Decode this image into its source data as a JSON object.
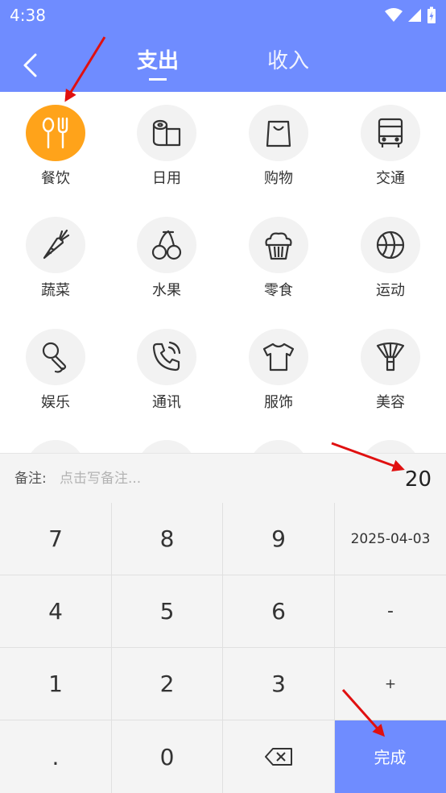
{
  "status_bar": {
    "time": "4:38"
  },
  "header": {
    "tabs": [
      {
        "label": "支出",
        "active": true
      },
      {
        "label": "收入",
        "active": false
      }
    ]
  },
  "categories": [
    {
      "label": "餐饮",
      "icon": "utensils-icon",
      "selected": true
    },
    {
      "label": "日用",
      "icon": "tissue-roll-icon",
      "selected": false
    },
    {
      "label": "购物",
      "icon": "shopping-bag-icon",
      "selected": false
    },
    {
      "label": "交通",
      "icon": "bus-icon",
      "selected": false
    },
    {
      "label": "蔬菜",
      "icon": "carrot-icon",
      "selected": false
    },
    {
      "label": "水果",
      "icon": "cherry-icon",
      "selected": false
    },
    {
      "label": "零食",
      "icon": "cupcake-icon",
      "selected": false
    },
    {
      "label": "运动",
      "icon": "basketball-icon",
      "selected": false
    },
    {
      "label": "娱乐",
      "icon": "microphone-icon",
      "selected": false
    },
    {
      "label": "通讯",
      "icon": "phone-icon",
      "selected": false
    },
    {
      "label": "服饰",
      "icon": "tshirt-icon",
      "selected": false
    },
    {
      "label": "美容",
      "icon": "brush-icon",
      "selected": false
    }
  ],
  "note": {
    "label": "备注:",
    "placeholder": "点击写备注...",
    "value": ""
  },
  "amount": "20",
  "keypad": {
    "k7": "7",
    "k8": "8",
    "k9": "9",
    "date": "2025-04-03",
    "k4": "4",
    "k5": "5",
    "k6": "6",
    "minus": "-",
    "k1": "1",
    "k2": "2",
    "k3": "3",
    "plus": "+",
    "dot": ".",
    "k0": "0",
    "done": "完成"
  },
  "colors": {
    "primary": "#6f8cff",
    "selected_category": "#ffa31a",
    "annotation_arrow": "#e01010"
  }
}
